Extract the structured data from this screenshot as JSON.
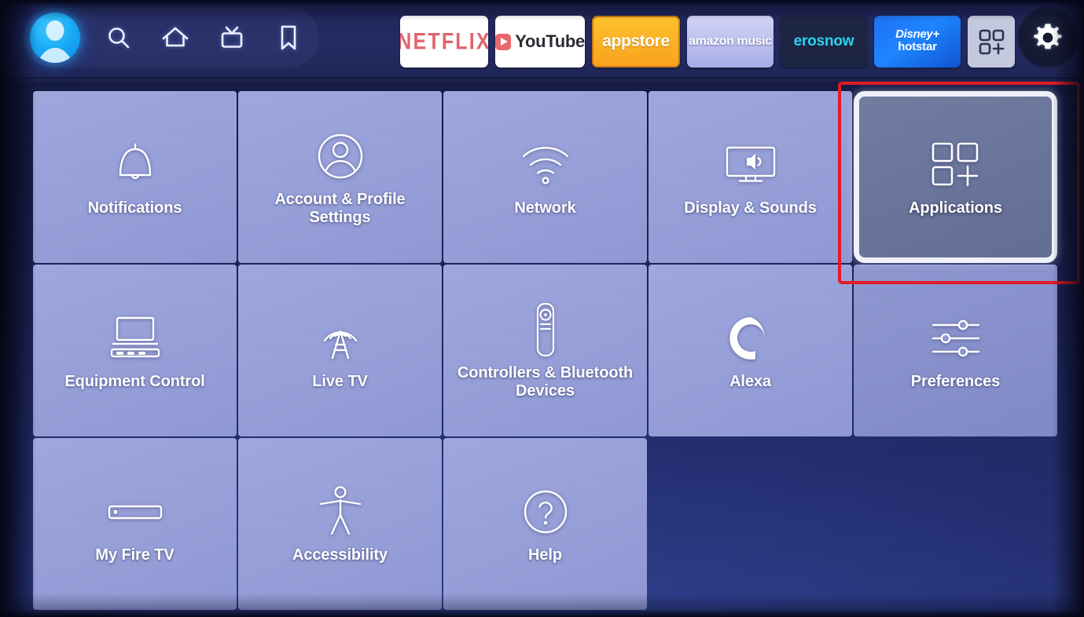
{
  "header": {
    "avatar": {
      "name": "profile-avatar"
    },
    "nav_icons": [
      {
        "name": "search-icon",
        "label": "Search"
      },
      {
        "name": "home-icon",
        "label": "Home"
      },
      {
        "name": "live-tv-icon",
        "label": "Live TV"
      },
      {
        "name": "bookmark-icon",
        "label": "Watchlist"
      }
    ],
    "apps": [
      {
        "name": "netflix-app",
        "label": "NETFLIX",
        "bg": "#ffffff",
        "fg": "#e0636b"
      },
      {
        "name": "youtube-app",
        "label": "YouTube",
        "bg": "#ffffff",
        "fg": "#2a2a33"
      },
      {
        "name": "appstore-app",
        "label": "appstore",
        "bg": "#fbb11d",
        "fg": "#ffffff"
      },
      {
        "name": "amazon-music-app",
        "label": "amazon music",
        "bg": "#b6bbee",
        "fg": "#ffffff"
      },
      {
        "name": "erosnow-app",
        "label": "erosnow",
        "bg": "#1a2340",
        "fg": "#2ad4f0"
      },
      {
        "name": "disney-hotstar-app",
        "label_top": "Disney+",
        "label_bottom": "hotstar",
        "bg": "#1b78f2",
        "fg": "#ffffff"
      }
    ],
    "apps_grid_button": {
      "name": "all-apps-button",
      "label": "App grid"
    },
    "settings_gear": {
      "name": "settings-gear-button",
      "label": "Settings"
    }
  },
  "grid": {
    "tiles": [
      {
        "id": "notifications",
        "label": "Notifications",
        "icon": "bell-icon",
        "selected": false,
        "dim": false
      },
      {
        "id": "account-profile",
        "label": "Account & Profile Settings",
        "icon": "person-circle-icon",
        "selected": false,
        "dim": false
      },
      {
        "id": "network",
        "label": "Network",
        "icon": "wifi-icon",
        "selected": false,
        "dim": false
      },
      {
        "id": "display-sounds",
        "label": "Display & Sounds",
        "icon": "display-audio-icon",
        "selected": false,
        "dim": false
      },
      {
        "id": "applications",
        "label": "Applications",
        "icon": "app-grid-icon",
        "selected": true,
        "dim": false
      },
      {
        "id": "equipment-control",
        "label": "Equipment Control",
        "icon": "monitor-keyboard-icon",
        "selected": false,
        "dim": false
      },
      {
        "id": "live-tv",
        "label": "Live TV",
        "icon": "antenna-icon",
        "selected": false,
        "dim": false
      },
      {
        "id": "controllers-bluetooth",
        "label": "Controllers & Bluetooth Devices",
        "icon": "remote-control-icon",
        "selected": false,
        "dim": false
      },
      {
        "id": "alexa",
        "label": "Alexa",
        "icon": "alexa-ring-icon",
        "selected": false,
        "dim": false
      },
      {
        "id": "preferences",
        "label": "Preferences",
        "icon": "sliders-icon",
        "selected": false,
        "dim": true
      },
      {
        "id": "my-fire-tv",
        "label": "My Fire TV",
        "icon": "fire-tv-stick-icon",
        "selected": false,
        "dim": false
      },
      {
        "id": "accessibility",
        "label": "Accessibility",
        "icon": "accessibility-icon",
        "selected": false,
        "dim": false
      },
      {
        "id": "help",
        "label": "Help",
        "icon": "question-circle-icon",
        "selected": false,
        "dim": false
      }
    ]
  },
  "annotation": {
    "name": "applications-highlight-box",
    "color": "#e01a22",
    "targets": "applications"
  }
}
